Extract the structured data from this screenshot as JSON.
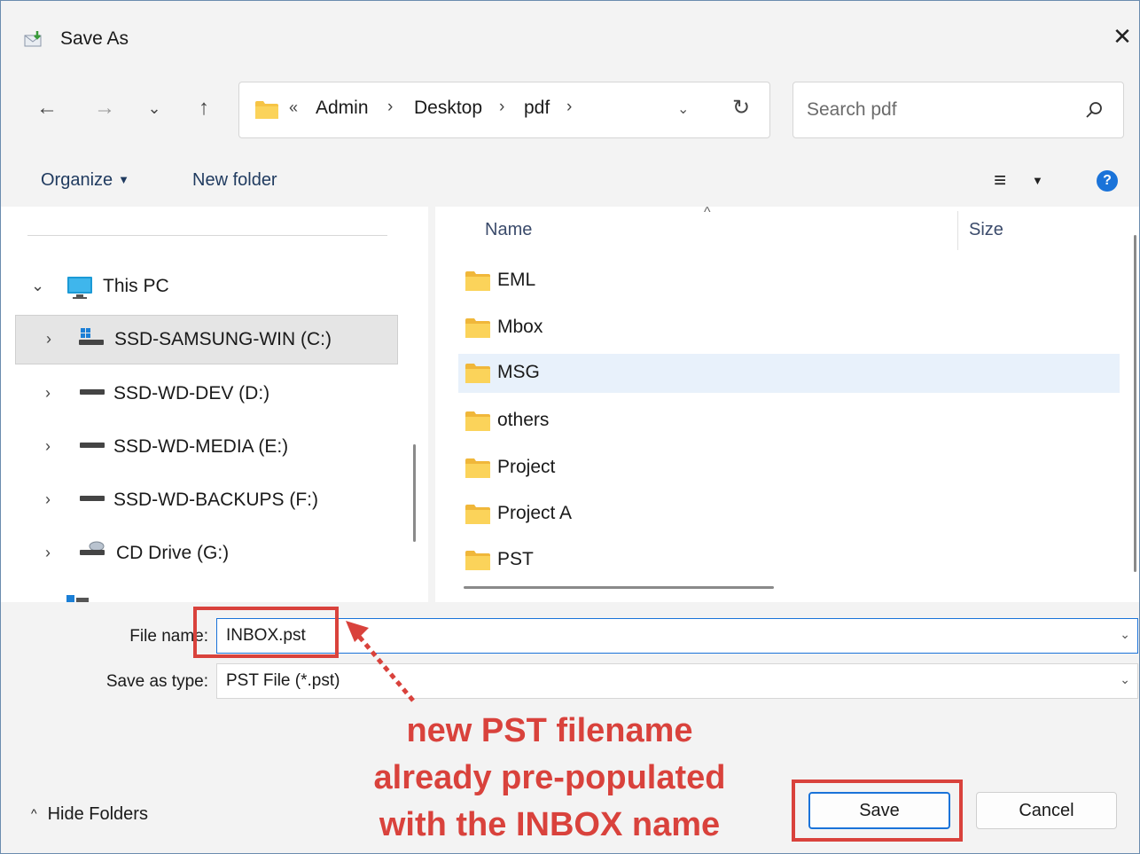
{
  "window": {
    "title": "Save As",
    "close_glyph": "✕"
  },
  "nav": {
    "back_glyph": "←",
    "forward_glyph": "→",
    "recent_glyph": "⌄",
    "up_glyph": "↑",
    "overflow": "«",
    "breadcrumbs": [
      "Admin",
      "Desktop",
      "pdf"
    ],
    "separator": "›",
    "dropdown_glyph": "⌄",
    "refresh_glyph": "↻"
  },
  "search": {
    "placeholder": "Search pdf"
  },
  "toolbar": {
    "organize_label": "Organize",
    "organize_caret": "▼",
    "new_folder_label": "New folder",
    "view_glyph": "≡",
    "view_caret": "▼",
    "help_glyph": "?"
  },
  "navpane": {
    "items": [
      {
        "label": "This PC",
        "arrow": "⌄",
        "icon": "monitor-icon"
      },
      {
        "label": "SSD-SAMSUNG-WIN (C:)",
        "arrow": "›",
        "icon": "windows-drive-icon"
      },
      {
        "label": "SSD-WD-DEV (D:)",
        "arrow": "›",
        "icon": "drive-icon"
      },
      {
        "label": "SSD-WD-MEDIA (E:)",
        "arrow": "›",
        "icon": "drive-icon"
      },
      {
        "label": "SSD-WD-BACKUPS (F:)",
        "arrow": "›",
        "icon": "drive-icon"
      },
      {
        "label": "CD Drive (G:)",
        "arrow": "›",
        "icon": "cd-drive-icon"
      }
    ]
  },
  "filelist": {
    "columns": {
      "name": "Name",
      "size": "Size",
      "sort_glyph": "^"
    },
    "rows": [
      {
        "name": "EML"
      },
      {
        "name": "Mbox"
      },
      {
        "name": "MSG"
      },
      {
        "name": "others"
      },
      {
        "name": "Project"
      },
      {
        "name": "Project A"
      },
      {
        "name": "PST"
      }
    ]
  },
  "form": {
    "file_name_label": "File name:",
    "file_name_value": "INBOX.pst",
    "save_type_label": "Save as type:",
    "save_type_value": "PST File (*.pst)",
    "combo_caret": "⌄"
  },
  "footer": {
    "hide_folders_label": "Hide Folders",
    "hide_folders_glyph": "^",
    "save_label": "Save",
    "cancel_label": "Cancel"
  },
  "annotation": {
    "lines": [
      "new PST filename",
      "already pre-populated",
      "with the INBOX name"
    ],
    "color": "#d9423c"
  },
  "colors": {
    "accent": "#1a73d9",
    "selection": "#e8f1fb",
    "folder": "#f6c445"
  }
}
